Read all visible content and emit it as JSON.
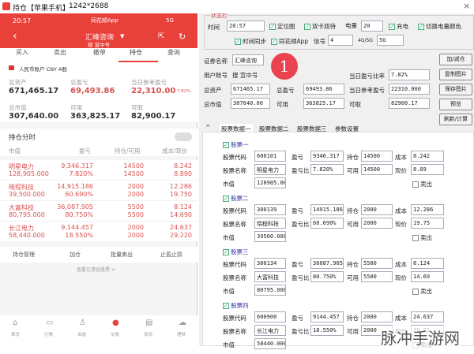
{
  "window": {
    "title": "持仓【苹果手机】",
    "resolution": "1242*2688",
    "close": "×"
  },
  "phone": {
    "status": {
      "time": "20:57",
      "app": "同花顺App",
      "signal": "5G"
    },
    "nav": {
      "account": "汇峰咨询",
      "sub": "搜 宣中号"
    },
    "tabs": [
      "买入",
      "卖出",
      "撤单",
      "持仓",
      "查询"
    ],
    "active_tab": 3,
    "account_type": "人民币账户 CNY A股",
    "summary": [
      {
        "label": "总资产",
        "value": "671,465.17"
      },
      {
        "label": "总盈亏",
        "value": "69,493.86"
      },
      {
        "label": "当日参考盈亏",
        "value": "22,310.00",
        "pct": "7.82%"
      },
      {
        "label": "总市值",
        "value": "307,640.00"
      },
      {
        "label": "可用",
        "value": "363,825.17"
      },
      {
        "label": "可取",
        "value": "82,900.17"
      }
    ],
    "section": "持仓分时",
    "headers": [
      "市值",
      "盈亏",
      "持仓/可用",
      "成本/现价"
    ],
    "stocks": [
      {
        "name": "明星电力",
        "mv": "128,905.000",
        "pl": "9,346.317",
        "plp": "7.820%",
        "hold": "14500",
        "avail": "14500",
        "cost": "8.242",
        "price": "8.890"
      },
      {
        "name": "晓程科技",
        "mv": "39,500.000",
        "pl": "14,915.186",
        "plp": "60.690%",
        "hold": "2000",
        "avail": "2000",
        "cost": "12.286",
        "price": "19.750"
      },
      {
        "name": "大富科技",
        "mv": "80,795.000",
        "pl": "36,087.905",
        "plp": "80.750%",
        "hold": "5500",
        "avail": "5500",
        "cost": "8.124",
        "price": "14.690"
      },
      {
        "name": "长江电力",
        "mv": "58,440.000",
        "pl": "9,144.457",
        "plp": "18.550%",
        "hold": "2000",
        "avail": "2000",
        "cost": "24.637",
        "price": "29.220"
      }
    ],
    "actions": [
      "持仓管理",
      "加仓",
      "批量卖出",
      "止盈止损"
    ],
    "cleared": "查看已清仓股票 >",
    "bottom_nav": [
      "首页",
      "行情",
      "自选",
      "交易",
      "资讯",
      "理财"
    ]
  },
  "panel": {
    "status_group": "状态栏",
    "time_label": "时间",
    "time": "20:57",
    "checks": {
      "locate": "定位图",
      "dual": "双卡双待",
      "charge": "充电",
      "battery_color": "切换电量颜色",
      "time_sync": "时间同步",
      "ths": "同花顺App"
    },
    "battery_label": "电量",
    "battery": "20",
    "signal_label": "信号",
    "signal": "4",
    "net_label": "4G/5G",
    "net": "5G",
    "fields": {
      "name_label": "证券名称",
      "name": "汇峰咨询",
      "user_label": "用户账号",
      "user": "搜 宣中号",
      "total_label": "总资产",
      "total": "671465.17",
      "pl_label": "总盈亏",
      "pl": "69493.86",
      "mv_label": "总市值",
      "mv": "307640.00",
      "avail_label": "可用",
      "avail": "363825.17",
      "ratio_label": "当日盈亏比率",
      "ratio": "7.82%",
      "ref_label": "当日参考盈亏",
      "ref": "22310.000",
      "draw_label": "可取",
      "draw": "82900.17"
    },
    "buttons": [
      "加/减仓",
      "复制图片",
      "保存图片",
      "预览",
      "刷新/计算"
    ],
    "tabs": [
      "股票数据一",
      "股票数据二",
      "股票数据三",
      "参数设置"
    ],
    "labels": {
      "code": "股票代码",
      "name": "股票名称",
      "mv": "市值",
      "pl": "盈亏",
      "plp": "盈亏比",
      "hold": "持仓",
      "avail": "可用",
      "cost": "成本",
      "price": "现价",
      "sell": "卖出"
    },
    "groups": [
      {
        "title": "股票一",
        "code": "600101",
        "name": "明星电力",
        "mv": "128905.000",
        "pl": "9346.317",
        "plp": "7.820%",
        "hold": "14500",
        "avail": "14500",
        "cost": "8.242",
        "price": "8.89"
      },
      {
        "title": "股票二",
        "code": "300139",
        "name": "晓程科技",
        "mv": "39500.000",
        "pl": "14915.186",
        "plp": "60.690%",
        "hold": "2000",
        "avail": "2000",
        "cost": "12.286",
        "price": "19.75"
      },
      {
        "title": "股票三",
        "code": "300134",
        "name": "大富科技",
        "mv": "80795.000",
        "pl": "36087.905",
        "plp": "80.750%",
        "hold": "5500",
        "avail": "5500",
        "cost": "8.124",
        "price": "14.69"
      },
      {
        "title": "股票四",
        "code": "600900",
        "name": "长江电力",
        "mv": "58440.000",
        "pl": "9144.457",
        "plp": "18.550%",
        "hold": "2000",
        "avail": "2000",
        "cost": "24.637",
        "price": "29.22"
      }
    ]
  },
  "badge": "1",
  "watermark": "脉冲手游网",
  "colors": {
    "brand_red": "#e8413a",
    "profit_red": "#d9534f"
  }
}
